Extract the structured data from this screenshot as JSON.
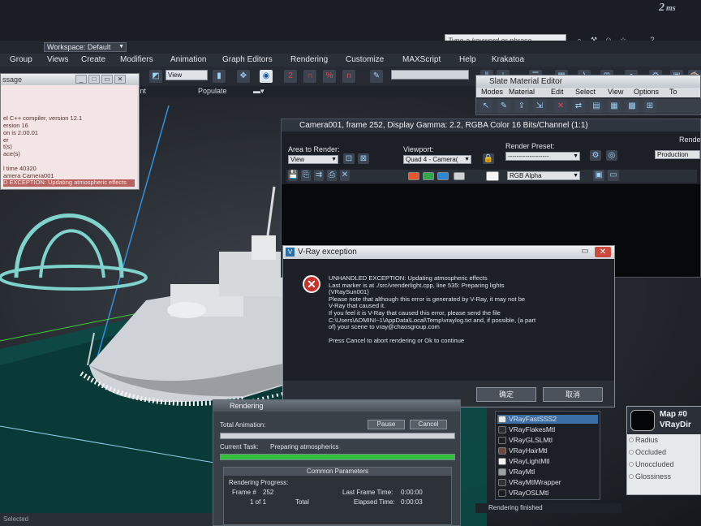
{
  "app": {
    "logo": "2",
    "logo_sub": "ms",
    "workspace": "Workspace: Default",
    "search_placeholder": "Type a keyword or phrase"
  },
  "menu": [
    "Group",
    "Views",
    "Create",
    "Modifiers",
    "Animation",
    "Graph Editors",
    "Rendering",
    "Customize",
    "MAXScript",
    "Help",
    "Krakatoa"
  ],
  "toolbar": {
    "view_combo": "View",
    "snap_labels": [
      "2",
      "%",
      "n"
    ]
  },
  "ribbon": [
    "ct Paint",
    "Populate"
  ],
  "listener": {
    "title": "ssage",
    "lines": [
      "",
      "",
      "",
      "",
      "el C++ compiler, version 12.1",
      "ersion 16",
      "on is 2.00.01",
      "er",
      "t(s)",
      "ace(s)",
      "",
      "l time 40320",
      "amera Camera001",
      "D EXCEPTION: Updating atmospheric effects"
    ]
  },
  "slate": {
    "title": "Slate Material Editor",
    "menu": [
      "Modes",
      "Material",
      "Edit",
      "Select",
      "View",
      "Options",
      "To"
    ]
  },
  "render_frame": {
    "title": "Camera001, frame 252, Display Gamma: 2.2, RGBA Color 16 Bits/Channel (1:1)",
    "area_label": "Area to Render:",
    "area_value": "View",
    "viewport_label": "Viewport:",
    "viewport_value": "Quad 4 - Camera(",
    "preset_label": "Render Preset:",
    "preset_value": "-------------------",
    "production_value": "Production",
    "render_label": "Rende",
    "channel_value": "RGB Alpha"
  },
  "vray_dialog": {
    "title": "V-Ray exception",
    "message": [
      "UNHANDLED EXCEPTION: Updating atmospheric effects",
      "Last marker is at ./src/vrenderlight.cpp, line 535: Preparing lights",
      "(VRaySun001)",
      "Please note that although this error is generated by V-Ray, it may not be",
      "V-Ray that caused it.",
      "If you feel it is V-Ray that caused this error, please send the file",
      "C:\\Users\\ADMINI~1\\AppData\\Local\\Temp\\vraylog.txt and, if possible, (a part",
      "of) your scene to vray@chaosgroup.com",
      "",
      "Press Cancel to abort rendering or Ok to continue"
    ],
    "ok_label": "确定",
    "cancel_label": "取消"
  },
  "rendering": {
    "title": "Rendering",
    "total_label": "Total Animation:",
    "pause_label": "Pause",
    "cancel_label": "Cancel",
    "task_label": "Current Task:",
    "task_value": "Preparing atmospherics",
    "total_progress": 0,
    "task_progress": 1,
    "common_params": "Common Parameters",
    "progress_label": "Rendering Progress:",
    "frame_label": "Frame #",
    "frame_value": "252",
    "of_label": "1 of 1",
    "total_word": "Total",
    "last_frame_label": "Last Frame Time:",
    "last_frame_value": "0:00:00",
    "elapsed_label": "Elapsed Time:",
    "elapsed_value": "0:00:03"
  },
  "materials": [
    {
      "name": "VRayFastSSS2",
      "color": "#e8ecef"
    },
    {
      "name": "VRayFlakesMtl",
      "color": "#2a2e33"
    },
    {
      "name": "VRayGLSLMtl",
      "color": "#1c1f23"
    },
    {
      "name": "VRayHairMtl",
      "color": "#6a4a3a"
    },
    {
      "name": "VRayLightMtl",
      "color": "#f2f2f2"
    },
    {
      "name": "VRayMtl",
      "color": "#9aa0a6"
    },
    {
      "name": "VRayMtlWrapper",
      "color": "#2e3237"
    },
    {
      "name": "VRayOSLMtl",
      "color": "#1a1d21"
    }
  ],
  "map_node": {
    "title": "Map #0",
    "subtitle": "VRayDir",
    "slots": [
      "Radius",
      "Occluded",
      "Unoccluded",
      "Glossiness"
    ]
  },
  "status": {
    "render_status": "Rendering finished",
    "bottom": "Selected"
  },
  "colors": {
    "error_red": "#c9312b",
    "progress_green": "#2fc23a",
    "gizmo_cyan": "#7fd3cc"
  }
}
